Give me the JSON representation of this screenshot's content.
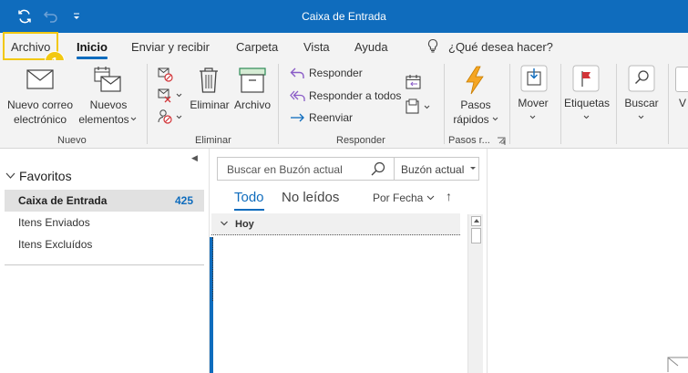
{
  "window": {
    "title": "Caixa de Entrada"
  },
  "qat": {
    "sync_icon": "sync-icon",
    "undo_icon": "undo-icon",
    "customize_icon": "customize-qat-icon"
  },
  "tabs": [
    {
      "label": "Archivo",
      "active": false
    },
    {
      "label": "Inicio",
      "active": true
    },
    {
      "label": "Enviar y recibir",
      "active": false
    },
    {
      "label": "Carpeta",
      "active": false
    },
    {
      "label": "Vista",
      "active": false
    },
    {
      "label": "Ayuda",
      "active": false
    }
  ],
  "tell_me": {
    "label": "¿Qué desea hacer?"
  },
  "callout": {
    "number": "1",
    "color": "#f2c811"
  },
  "ribbon": {
    "nuevo": {
      "group": "Nuevo",
      "new_email": [
        "Nuevo correo",
        "electrónico"
      ],
      "new_items": [
        "Nuevos",
        "elementos"
      ]
    },
    "eliminar": {
      "group": "Eliminar",
      "delete": "Eliminar",
      "archive": "Archivo"
    },
    "responder": {
      "group": "Responder",
      "reply": "Responder",
      "reply_all": "Responder a todos",
      "forward": "Reenviar"
    },
    "pasos": {
      "group": "Pasos r...",
      "quick_steps": [
        "Pasos",
        "rápidos"
      ]
    },
    "move": {
      "label": "Mover"
    },
    "tags": {
      "label": "Etiquetas"
    },
    "find": {
      "label": "Buscar"
    },
    "partial": {
      "label": "V"
    }
  },
  "folders": {
    "favorites_label": "Favoritos",
    "items": [
      {
        "name": "Caixa de Entrada",
        "count": "425",
        "selected": true
      },
      {
        "name": "Itens Enviados",
        "count": "",
        "selected": false
      },
      {
        "name": "Itens Excluídos",
        "count": "",
        "selected": false
      }
    ]
  },
  "message_list": {
    "search_placeholder": "Buscar en Buzón actual",
    "search_scope": "Buzón actual",
    "filter_all": "Todo",
    "filter_unread": "No leídos",
    "sort_by": "Por Fecha",
    "sort_direction": "↑",
    "group_header": "Hoy"
  },
  "colors": {
    "accent": "#0f6cbd",
    "highlight": "#f2c811",
    "ribbon_bg": "#f3f3f3",
    "quick_steps_icon": "#f5a623",
    "flag_red": "#d13438"
  }
}
